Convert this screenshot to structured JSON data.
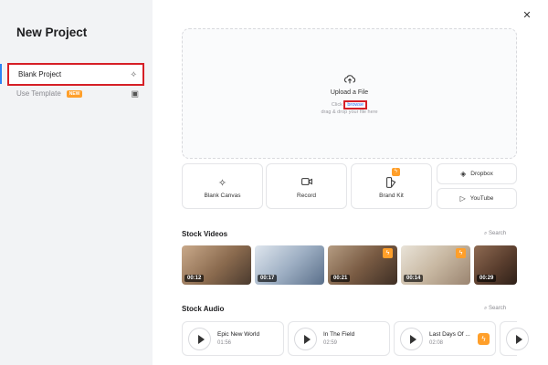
{
  "sidebar": {
    "title": "New Project",
    "items": [
      {
        "label": "Blank Project",
        "icon": "sparkle-icon"
      },
      {
        "label": "Use Template",
        "badge": "NEW",
        "icon": "layout-icon"
      }
    ]
  },
  "upload": {
    "title": "Upload a File",
    "line1_prefix": "Click ",
    "browse_label": "browse",
    "line2": "drag & drop your file here"
  },
  "actions": [
    {
      "label": "Blank Canvas",
      "icon": "sparkle-icon"
    },
    {
      "label": "Record",
      "icon": "camera-icon"
    },
    {
      "label": "Brand Kit",
      "icon": "brand-kit-icon"
    }
  ],
  "integrations": [
    {
      "label": "Dropbox",
      "icon": "dropbox-icon"
    },
    {
      "label": "YouTube",
      "icon": "youtube-icon"
    }
  ],
  "stock_videos": {
    "title": "Stock Videos",
    "search_label": "Search",
    "items": [
      {
        "duration": "00:12",
        "premium": false
      },
      {
        "duration": "00:17",
        "premium": false
      },
      {
        "duration": "00:21",
        "premium": true
      },
      {
        "duration": "00:14",
        "premium": true
      },
      {
        "duration": "00:29",
        "premium": false
      }
    ]
  },
  "stock_audio": {
    "title": "Stock Audio",
    "search_label": "Search",
    "items": [
      {
        "title": "Epic New World",
        "duration": "01:56",
        "premium": false
      },
      {
        "title": "In The Field",
        "duration": "02:59",
        "premium": false
      },
      {
        "title": "Last Days Of ...",
        "duration": "02:08",
        "premium": true
      }
    ]
  },
  "colors": {
    "accent": "#2c83f5",
    "highlight": "#d61f26",
    "premium": "#ff9f2a"
  }
}
